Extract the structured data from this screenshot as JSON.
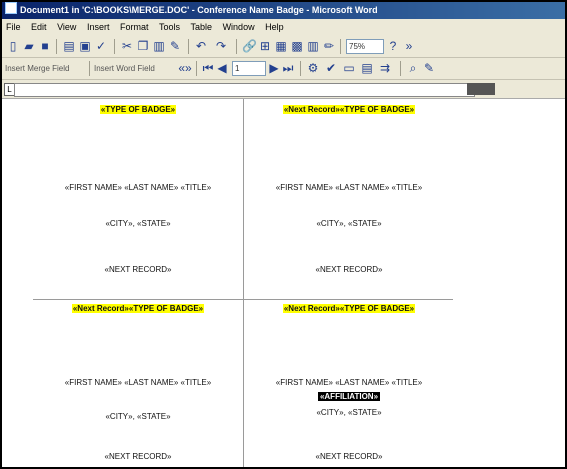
{
  "window": {
    "title": "Document1 in 'C:\\BOOKS\\MERGE.DOC' - Conference Name Badge - Microsoft Word"
  },
  "menu": [
    "File",
    "Edit",
    "View",
    "Insert",
    "Format",
    "Tools",
    "Table",
    "Window",
    "Help"
  ],
  "toolbar1": {
    "zoom_value": "75%"
  },
  "toolbar2": {
    "insert_merge_field": "Insert Merge Field",
    "insert_word_field": "Insert Word Field",
    "record_value": "1"
  },
  "labels": [
    {
      "header": "«TYPE OF BADGE»",
      "name_line": "«FIRST NAME» «LAST NAME» «TITLE»",
      "affiliation": "",
      "city_state": "«CITY», «STATE»",
      "bottom": "«NEXT RECORD»"
    },
    {
      "header": "«Next Record»«TYPE OF BADGE»",
      "name_line": "«FIRST NAME» «LAST NAME» «TITLE»",
      "affiliation": "",
      "city_state": "«CITY», «STATE»",
      "bottom": "«NEXT RECORD»"
    },
    {
      "header": "«Next Record»«TYPE OF BADGE»",
      "name_line": "«FIRST NAME» «LAST NAME» «TITLE»",
      "affiliation": "",
      "city_state": "«CITY», «STATE»",
      "bottom": "«NEXT RECORD»"
    },
    {
      "header": "«Next Record»«TYPE OF BADGE»",
      "name_line": "«FIRST NAME» «LAST NAME» «TITLE»",
      "affiliation": "«AFFILIATION»",
      "city_state": "«CITY», «STATE»",
      "bottom": "«NEXT RECORD»"
    }
  ]
}
